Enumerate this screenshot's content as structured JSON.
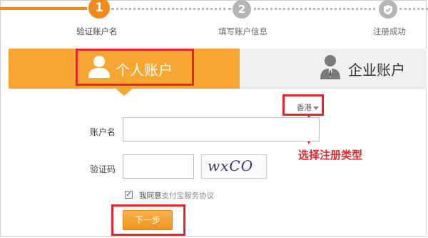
{
  "steps": [
    {
      "number": "1",
      "label": "验证账户名",
      "state": "active"
    },
    {
      "number": "2",
      "label": "填写账户信息",
      "state": "pending"
    },
    {
      "number": "",
      "label": "注册成功",
      "state": "pending",
      "icon": "check-shield-icon"
    }
  ],
  "tabs": {
    "personal": {
      "label": "个人账户",
      "icon": "person-icon",
      "selected": true
    },
    "enterprise": {
      "label": "企业账户",
      "icon": "business-person-icon",
      "selected": false
    }
  },
  "form": {
    "region": "香港",
    "account_label": "账户名",
    "account_value": "",
    "captcha_label": "验证码",
    "captcha_value": "",
    "captcha_image_text": "wxCO",
    "agree_prefix": "我同意",
    "agree_link": "支付宝服务协议",
    "agree_checked": true,
    "next_button": "下一步"
  },
  "annotation": {
    "text": "选择注册类型",
    "color": "#e4262d"
  },
  "colors": {
    "accent": "#f7a631",
    "step_active": "#f28a1a",
    "step_inactive": "#b5b5b5",
    "highlight": "#e4262d"
  }
}
